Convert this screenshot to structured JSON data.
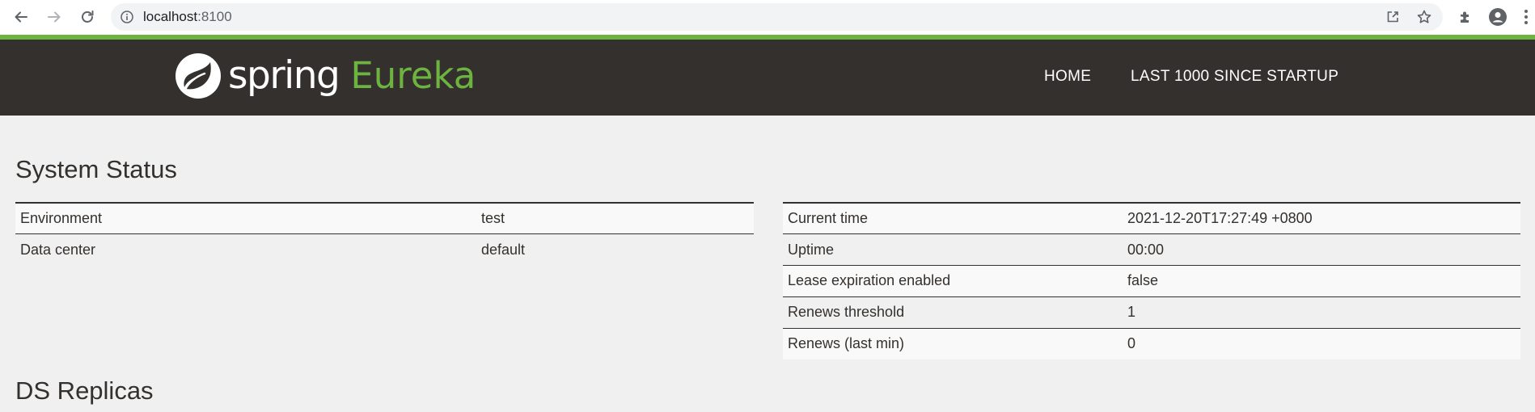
{
  "browser": {
    "url_host": "localhost",
    "url_port": ":8100"
  },
  "header": {
    "logo_spring": "spring",
    "logo_eureka": "Eureka",
    "nav": [
      "HOME",
      "LAST 1000 SINCE STARTUP"
    ]
  },
  "system_status": {
    "title": "System Status",
    "left_rows": [
      {
        "key": "Environment",
        "value": "test"
      },
      {
        "key": "Data center",
        "value": "default"
      }
    ],
    "right_rows": [
      {
        "key": "Current time",
        "value": "2021-12-20T17:27:49 +0800"
      },
      {
        "key": "Uptime",
        "value": "00:00"
      },
      {
        "key": "Lease expiration enabled",
        "value": "false"
      },
      {
        "key": "Renews threshold",
        "value": "1"
      },
      {
        "key": "Renews (last min)",
        "value": "0"
      }
    ]
  },
  "ds_replicas": {
    "title": "DS Replicas"
  },
  "colors": {
    "brand_green": "#6db33f",
    "header_bg": "#34302d",
    "page_bg": "#f0f0f0"
  },
  "icons": [
    "back-arrow-icon",
    "forward-arrow-icon",
    "reload-icon",
    "info-icon",
    "share-icon",
    "bookmark-star-icon",
    "extensions-puzzle-icon",
    "profile-avatar-icon",
    "kebab-menu-icon",
    "spring-leaf-icon"
  ]
}
